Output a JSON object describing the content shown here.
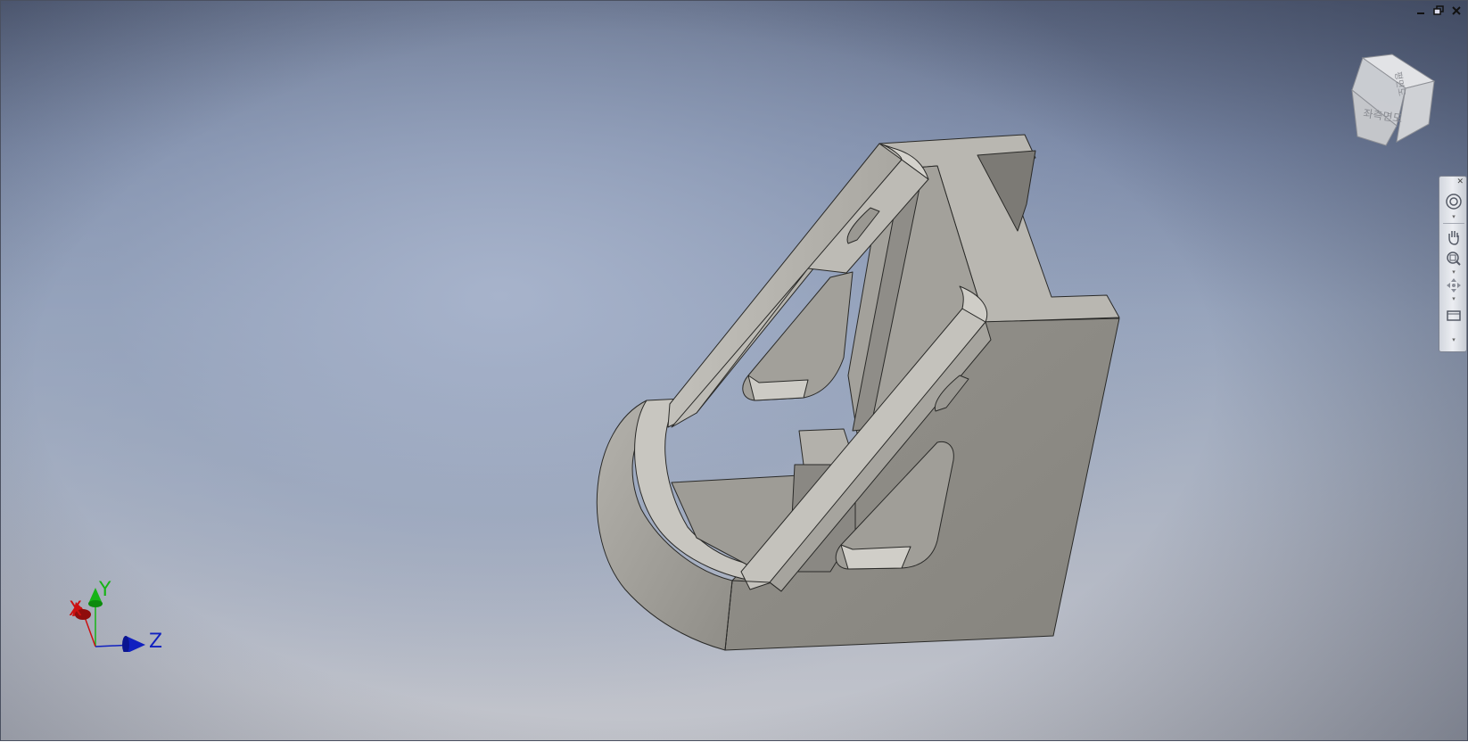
{
  "window": {
    "minimize_icon": "minimize-icon",
    "restore_icon": "restore-icon",
    "close_icon": "close-icon"
  },
  "viewcube": {
    "face_front": "좌측면도",
    "face_top": "평면도"
  },
  "triad": {
    "x_label": "X",
    "y_label": "Y",
    "z_label": "Z",
    "x_color": "#cc1010",
    "y_color": "#16b416",
    "z_color": "#1020c0"
  },
  "nav_bar": {
    "tools": [
      "steering-wheel-icon",
      "pan-icon",
      "zoom-icon",
      "orbit-icon",
      "look-at-icon"
    ]
  },
  "colors": {
    "model_face": "#8c8a84",
    "model_light": "#b6b4ae",
    "model_edge": "#2a2a28"
  }
}
